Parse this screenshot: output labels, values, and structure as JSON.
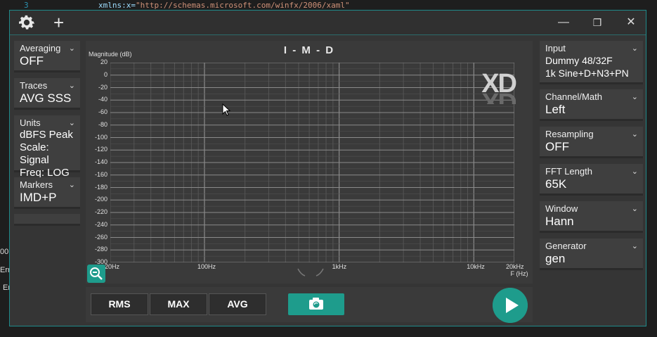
{
  "background": {
    "line_number": "3",
    "code_attr": "xmlns:x=",
    "code_value": "\"http://schemas.microsoft.com/winfx/2006/xaml\"",
    "left_fragments": [
      "00",
      "Err",
      "En"
    ]
  },
  "titlebar": {
    "minimize": "—",
    "restore": "❐",
    "close": "✕"
  },
  "left_panels": [
    {
      "label": "Averaging",
      "value": "OFF"
    },
    {
      "label": "Traces",
      "value": "AVG SSS"
    },
    {
      "label": "Units",
      "lines": [
        "dBFS Peak",
        "Scale: Signal",
        "Freq: LOG"
      ]
    },
    {
      "label": "Markers",
      "value": "IMD+P"
    }
  ],
  "right_panels": [
    {
      "label": "Input",
      "lines": [
        "Dummy 48/32F",
        "1k Sine+D+N3+PN"
      ]
    },
    {
      "label": "Channel/Math",
      "value": "Left"
    },
    {
      "label": "Resampling",
      "value": "OFF"
    },
    {
      "label": "FFT Length",
      "value": "65K"
    },
    {
      "label": "Window",
      "value": "Hann"
    },
    {
      "label": "Generator",
      "value": "gen"
    }
  ],
  "chart_data": {
    "type": "line",
    "title": "I - M - D",
    "ylabel": "Magnitude (dB)",
    "xlabel": "F (Hz)",
    "xscale": "log",
    "xlim": [
      20,
      20000
    ],
    "ylim": [
      -300,
      20
    ],
    "yticks": [
      20,
      0,
      -20,
      -40,
      -60,
      -80,
      -100,
      -120,
      -140,
      -160,
      -180,
      -200,
      -220,
      -240,
      -260,
      -280,
      -300
    ],
    "xtick_labels": [
      {
        "value": 20,
        "label": "20Hz"
      },
      {
        "value": 100,
        "label": "100Hz"
      },
      {
        "value": 1000,
        "label": "1kHz"
      },
      {
        "value": 10000,
        "label": "10kHz"
      },
      {
        "value": 20000,
        "label": "20kHz"
      }
    ],
    "grid": true,
    "series": []
  },
  "watermark": "XD",
  "controls": {
    "rms": "RMS",
    "max": "MAX",
    "avg": "AVG"
  },
  "colors": {
    "accent": "#1e9c8c",
    "panel": "#3f3f3f",
    "window_bg": "#353535",
    "grid_major": "#8a8a8a",
    "grid_minor": "#555555"
  }
}
